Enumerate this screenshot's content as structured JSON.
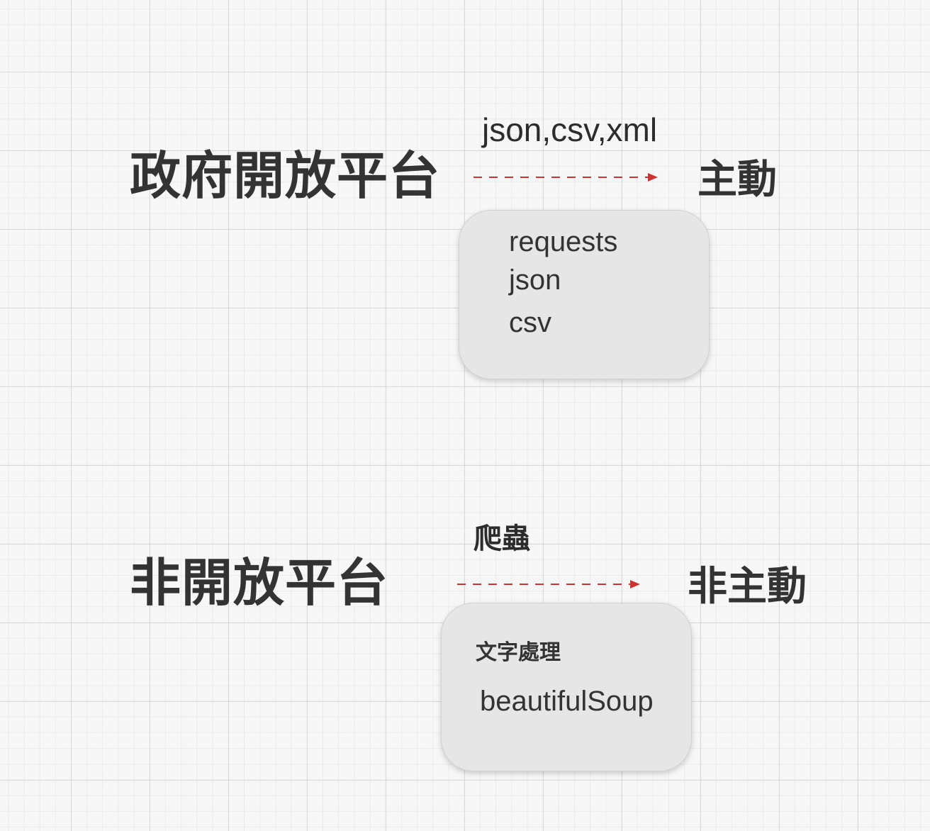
{
  "top": {
    "source": "政府開放平台",
    "edge_label": "json,csv,xml",
    "target": "主動",
    "tools": [
      "requests",
      "json",
      "csv"
    ]
  },
  "bottom": {
    "source": "非開放平台",
    "edge_label": "爬蟲",
    "target": "非主動",
    "tools": [
      "文字處理",
      "beautifulSoup"
    ]
  },
  "colors": {
    "arrow": "#cc3333",
    "text": "#333333",
    "box_fill": "#e6e6e6"
  }
}
